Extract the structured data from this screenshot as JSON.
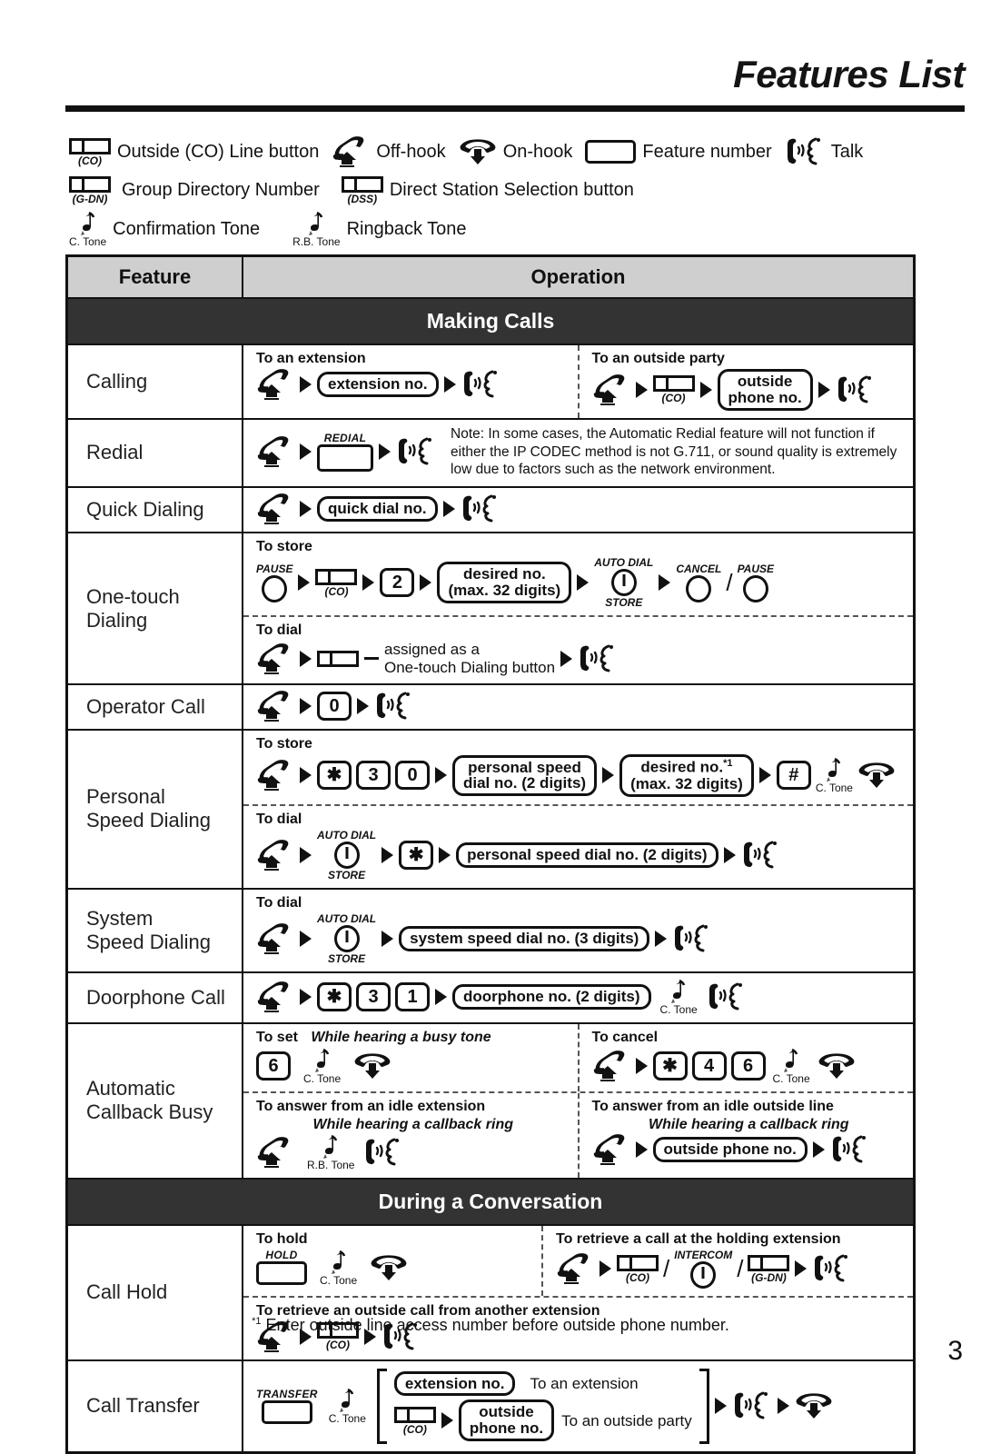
{
  "header": {
    "title": "Features List"
  },
  "legend": {
    "rows": [
      [
        {
          "icon": "co-line-button-icon",
          "caption": "(CO)",
          "text": "Outside (CO) Line button"
        },
        {
          "icon": "off-hook-icon",
          "text": "Off-hook"
        },
        {
          "icon": "on-hook-icon",
          "text": "On-hook"
        },
        {
          "icon": "feature-number-icon",
          "text": "Feature number"
        },
        {
          "icon": "talk-icon",
          "text": "Talk"
        }
      ],
      [
        {
          "icon": "g-dn-button-icon",
          "caption": "(G-DN)",
          "text": "Group Directory Number"
        },
        {
          "icon": "dss-button-icon",
          "caption": "(DSS)",
          "text": "Direct Station Selection button"
        }
      ],
      [
        {
          "icon": "confirmation-tone-icon",
          "caption": "C. Tone",
          "text": "Confirmation Tone"
        },
        {
          "icon": "ringback-tone-icon",
          "caption": "R.B. Tone",
          "text": "Ringback Tone"
        }
      ]
    ]
  },
  "table": {
    "header": {
      "feature": "Feature",
      "operation": "Operation"
    },
    "sections": {
      "making_calls": "Making Calls",
      "during_conversation": "During a Conversation"
    },
    "rows": {
      "calling": {
        "feature": "Calling",
        "left_label": "To an extension",
        "right_label": "To an outside party",
        "extension_pill": "extension no.",
        "co_caption": "(CO)",
        "outside_pill_line1": "outside",
        "outside_pill_line2": "phone no."
      },
      "redial": {
        "feature": "Redial",
        "button_label": "REDIAL",
        "note": "Note: In some cases, the Automatic Redial feature will not function if either the IP CODEC method is not G.711, or sound quality is extremely low due to factors such as the network environment."
      },
      "quick_dialing": {
        "feature": "Quick Dialing",
        "pill": "quick dial no."
      },
      "one_touch": {
        "feature_line1": "One-touch",
        "feature_line2": "Dialing",
        "store_label": "To store",
        "pause_label": "PAUSE",
        "co_caption": "(CO)",
        "key2": "2",
        "desired_line1": "desired no.",
        "desired_line2": "(max. 32 digits)",
        "autodial_top": "AUTO DIAL",
        "autodial_bottom": "STORE",
        "cancel_label": "CANCEL",
        "pause2_label": "PAUSE",
        "dial_label": "To dial",
        "assigned_line1": "assigned as a",
        "assigned_line2": "One-touch Dialing button"
      },
      "operator_call": {
        "feature": "Operator Call",
        "key0": "0"
      },
      "personal_speed": {
        "feature_line1": "Personal",
        "feature_line2": "Speed Dialing",
        "store_label": "To store",
        "key_star": "✱",
        "key3": "3",
        "key0": "0",
        "speed_pill_line1": "personal speed",
        "speed_pill_line2": "dial no. (2 digits)",
        "desired_line1": "desired no.",
        "desired_sup": "*1",
        "desired_line2": "(max. 32 digits)",
        "key_hash": "#",
        "ctone_caption": "C. Tone",
        "dial_label": "To dial",
        "autodial_top": "AUTO DIAL",
        "autodial_bottom": "STORE",
        "dial_star": "✱",
        "dial_pill": "personal speed dial no. (2 digits)"
      },
      "system_speed": {
        "feature_line1": "System",
        "feature_line2": "Speed Dialing",
        "dial_label": "To dial",
        "autodial_top": "AUTO DIAL",
        "autodial_bottom": "STORE",
        "pill": "system speed dial no. (3 digits)"
      },
      "doorphone": {
        "feature": "Doorphone Call",
        "key_star": "✱",
        "key3": "3",
        "key1": "1",
        "pill": "doorphone no. (2 digits)",
        "ctone_caption": "C. Tone"
      },
      "callback": {
        "feature_line1": "Automatic",
        "feature_line2": "Callback Busy",
        "set_label": "To set",
        "set_italic": "While hearing a busy tone",
        "key6": "6",
        "ctone_caption": "C. Tone",
        "cancel_label": "To cancel",
        "key_star": "✱",
        "key4": "4",
        "key6b": "6",
        "ctone_caption2": "C. Tone",
        "answer_ext_label": "To answer from an idle extension",
        "answer_ext_italic": "While hearing a callback ring",
        "rb_caption": "R.B. Tone",
        "answer_co_label": "To answer from an idle outside line",
        "answer_co_italic": "While hearing a callback ring",
        "outside_pill": "outside phone no."
      },
      "call_hold": {
        "feature": "Call Hold",
        "hold_label": "To hold",
        "hold_button": "HOLD",
        "ctone_caption": "C. Tone",
        "retrieve_label": "To retrieve a call at the holding extension",
        "co_caption": "(CO)",
        "intercom_label": "INTERCOM",
        "gdn_caption": "(G-DN)",
        "retrieve2_label": "To retrieve an outside call from another extension",
        "co_caption2": "(CO)"
      },
      "call_transfer": {
        "feature": "Call Transfer",
        "transfer_button": "TRANSFER",
        "ctone_caption": "C. Tone",
        "extension_pill": "extension no.",
        "to_extension": "To an extension",
        "co_caption": "(CO)",
        "outside_pill_line1": "outside",
        "outside_pill_line2": "phone no.",
        "to_outside": "To an outside party"
      }
    }
  },
  "footer": {
    "note_marker": "*1",
    "note": "Enter outside line access number before outside phone number.",
    "page_number": "3"
  }
}
